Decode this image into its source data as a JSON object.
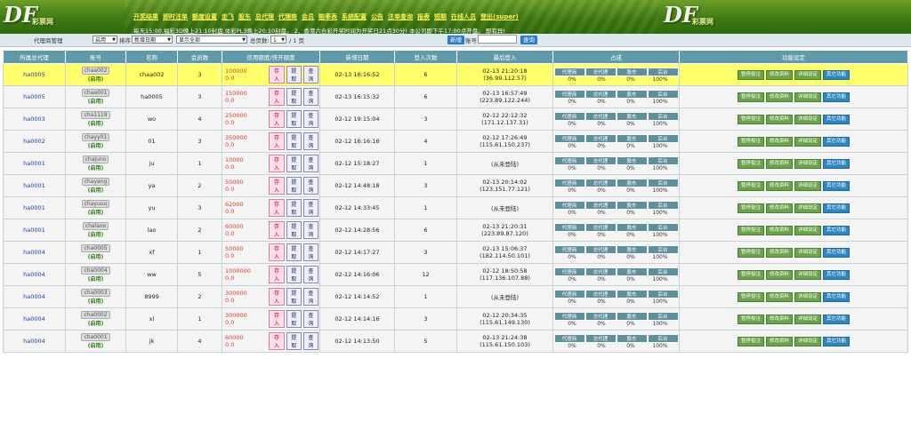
{
  "header": {
    "logo_text": "DF",
    "logo_sub": "彩票网",
    "nav": [
      "开奖结果",
      "即时注单",
      "额度设置",
      "走飞",
      "股东",
      "总代理",
      "代理商",
      "会员",
      "赔率表",
      "系统配置",
      "公告",
      "注单查询",
      "报表",
      "短期",
      "在线人员",
      "登出(super)"
    ],
    "notice": "每天15:00,福彩3D晚上21:10封盘,体彩PL3晚上20:10封盘。 2、香港六合彩开奖时间为开奖日21点30分! 本公司即下午17:00点开盘。 即有异!"
  },
  "toolbar": {
    "title": "代理商管理",
    "status_select": "启用",
    "sort_label": "排序",
    "sort_select": "新增日期",
    "filter_select": "显示全部",
    "pages_label": "总页数:",
    "page_value": "1",
    "pages_suffix": "/ 1 页",
    "add_button": "新增",
    "account_label": "账号",
    "search_button": "查询"
  },
  "table": {
    "headers": [
      "所属总代理",
      "账号",
      "名称",
      "会员数",
      "信用额度/快开额度",
      "新增日期",
      "登入次数",
      "最后登入",
      "占成",
      "功能设定"
    ],
    "share_headers": [
      "代理商",
      "总代理",
      "股东",
      "后台"
    ],
    "mini_buttons": [
      "存入",
      "提取",
      "查询"
    ],
    "function_buttons": [
      "暂停投注",
      "修改资料",
      "详细设定",
      "其它功能"
    ],
    "rows": [
      {
        "parent": "ha0005",
        "account": "chaa002",
        "state": "(启用)",
        "name": "chaa002",
        "members": "3",
        "credit": "100000",
        "quick": "0.0",
        "date": "02-13 16:16:52",
        "logins": "6",
        "last_login": "02-13 21:20:18",
        "last_ip": "(36.99.112.57)",
        "shares": [
          "0%",
          "0%",
          "0%",
          "100%"
        ],
        "highlight": true
      },
      {
        "parent": "ha0005",
        "account": "chaa001",
        "state": "(启用)",
        "name": "ha0005",
        "members": "3",
        "credit": "150000",
        "quick": "0.0",
        "date": "02-13 16:15:32",
        "logins": "6",
        "last_login": "02-13 16:57:49",
        "last_ip": "(223.89.122.244)",
        "shares": [
          "0%",
          "0%",
          "0%",
          "100%"
        ]
      },
      {
        "parent": "ha0003",
        "account": "cha1119",
        "state": "(启用)",
        "name": "wo",
        "members": "4",
        "credit": "250000",
        "quick": "0.0",
        "date": "02-12 19:15:04",
        "logins": "3",
        "last_login": "02-12 22:12:32",
        "last_ip": "(171.12.137.31)",
        "shares": [
          "0%",
          "0%",
          "0%",
          "100%"
        ]
      },
      {
        "parent": "ha0002",
        "account": "chayy01",
        "state": "(启用)",
        "name": "01",
        "members": "3",
        "credit": "350000",
        "quick": "0.0",
        "date": "02-12 16:16:16",
        "logins": "4",
        "last_login": "02-12 17:26:49",
        "last_ip": "(115.61.150.237)",
        "shares": [
          "0%",
          "0%",
          "0%",
          "100%"
        ]
      },
      {
        "parent": "ha0001",
        "account": "chajuno",
        "state": "(启用)",
        "name": "ju",
        "members": "1",
        "credit": "10000",
        "quick": "0.0",
        "date": "02-12 15:18:27",
        "logins": "1",
        "last_login": "",
        "last_ip": "(从未登陆)",
        "shares": [
          "0%",
          "0%",
          "0%",
          "100%"
        ]
      },
      {
        "parent": "ha0001",
        "account": "chayang",
        "state": "(启用)",
        "name": "ya",
        "members": "2",
        "credit": "50000",
        "quick": "0.0",
        "date": "02-12 14:48:18",
        "logins": "3",
        "last_login": "02-13 20:14:02",
        "last_ip": "(123.151.77.121)",
        "shares": [
          "0%",
          "0%",
          "0%",
          "100%"
        ]
      },
      {
        "parent": "ha0001",
        "account": "chayuuu",
        "state": "(启用)",
        "name": "yu",
        "members": "3",
        "credit": "62000",
        "quick": "0.0",
        "date": "02-12 14:33:45",
        "logins": "1",
        "last_login": "",
        "last_ip": "(从未登陆)",
        "shares": [
          "0%",
          "0%",
          "0%",
          "100%"
        ]
      },
      {
        "parent": "ha0001",
        "account": "chalaoo",
        "state": "(启用)",
        "name": "lao",
        "members": "2",
        "credit": "60000",
        "quick": "0.0",
        "date": "02-12 14:28:56",
        "logins": "6",
        "last_login": "02-13 21:20:31",
        "last_ip": "(223.89.87.120)",
        "shares": [
          "0%",
          "0%",
          "0%",
          "100%"
        ]
      },
      {
        "parent": "ha0004",
        "account": "cha0005",
        "state": "(启用)",
        "name": "xf",
        "members": "1",
        "credit": "50000",
        "quick": "0.0",
        "date": "02-12 14:17:27",
        "logins": "3",
        "last_login": "02-13 15:06:37",
        "last_ip": "(182.114.50.101)",
        "shares": [
          "0%",
          "0%",
          "0%",
          "100%"
        ]
      },
      {
        "parent": "ha0004",
        "account": "cha0004",
        "state": "(启用)",
        "name": "ww",
        "members": "5",
        "credit": "1000000",
        "quick": "0.0",
        "date": "02-12 14:16:06",
        "logins": "12",
        "last_login": "02-12 18:50:58",
        "last_ip": "(117.136.107.88)",
        "shares": [
          "0%",
          "0%",
          "0%",
          "100%"
        ]
      },
      {
        "parent": "ha0004",
        "account": "cha0003",
        "state": "(启用)",
        "name": "8999",
        "members": "2",
        "credit": "300000",
        "quick": "0.0",
        "date": "02-12 14:14:52",
        "logins": "1",
        "last_login": "",
        "last_ip": "(从未登陆)",
        "shares": [
          "0%",
          "0%",
          "0%",
          "100%"
        ]
      },
      {
        "parent": "ha0004",
        "account": "cha0002",
        "state": "(启用)",
        "name": "xl",
        "members": "1",
        "credit": "300000",
        "quick": "0.0",
        "date": "02-12 14:14:16",
        "logins": "3",
        "last_login": "02-12 20:34:35",
        "last_ip": "(115.61.149.130)",
        "shares": [
          "0%",
          "0%",
          "0%",
          "100%"
        ]
      },
      {
        "parent": "ha0004",
        "account": "cha0001",
        "state": "(启用)",
        "name": "jk",
        "members": "4",
        "credit": "60000",
        "quick": "0.0",
        "date": "02-12 14:13:50",
        "logins": "5",
        "last_login": "02-13 21:24:38",
        "last_ip": "(115.61.150.103)",
        "shares": [
          "0%",
          "0%",
          "0%",
          "100%"
        ]
      }
    ]
  },
  "colors": {
    "header_green": "#3f7a12",
    "nav_yellow": "#ffef4a",
    "table_head": "#5e9aa9",
    "highlight_row": "#ffff6b",
    "credit_red": "#e23a2a"
  }
}
